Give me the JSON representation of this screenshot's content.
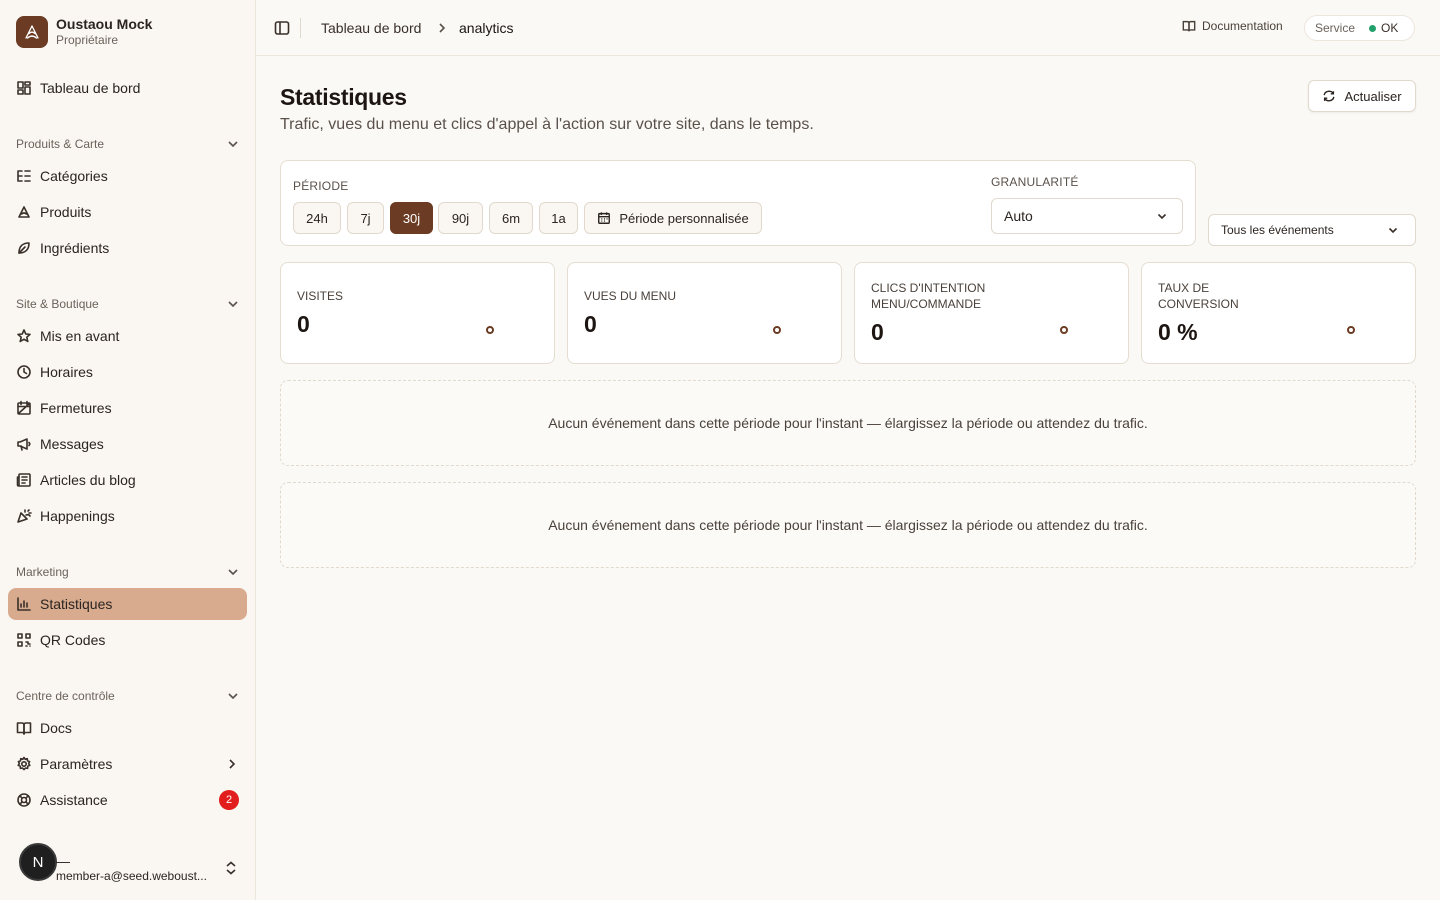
{
  "org": {
    "name": "Oustaou Mock",
    "role": "Propriétaire"
  },
  "nav": {
    "dashboard": "Tableau de bord",
    "sections": [
      {
        "title": "Produits & Carte",
        "items": [
          "Catégories",
          "Produits",
          "Ingrédients"
        ]
      },
      {
        "title": "Site & Boutique",
        "items": [
          "Mis en avant",
          "Horaires",
          "Fermetures",
          "Messages",
          "Articles du blog",
          "Happenings"
        ]
      },
      {
        "title": "Marketing",
        "items": [
          "Statistiques",
          "QR Codes"
        ]
      },
      {
        "title": "Centre de contrôle",
        "items": [
          "Docs",
          "Paramètres",
          "Assistance"
        ]
      }
    ],
    "active": "Statistiques",
    "assistance_badge": "2"
  },
  "user": {
    "initial": "N",
    "name": "—",
    "email": "member-a@seed.weboust..."
  },
  "topbar": {
    "breadcrumb": [
      "Tableau de bord",
      "analytics"
    ],
    "docs_label": "Documentation",
    "service_label": "Service",
    "service_status": "OK",
    "service_color": "#22a06b"
  },
  "page": {
    "title": "Statistiques",
    "subtitle": "Trafic, vues du menu et clics d'appel à l'action sur votre site, dans le temps.",
    "refresh_label": "Actualiser"
  },
  "filters": {
    "period_label": "PÉRIODE",
    "periods": [
      "24h",
      "7j",
      "30j",
      "90j",
      "6m",
      "1a"
    ],
    "active_period": "30j",
    "custom_label": "Période personnalisée",
    "granularity_label": "GRANULARITÉ",
    "granularity_value": "Auto",
    "events_value": "Tous les événements"
  },
  "stats": [
    {
      "label": "VISITES",
      "value": "0"
    },
    {
      "label": "VUES DU MENU",
      "value": "0"
    },
    {
      "label": "CLICS D'INTENTION MENU/COMMANDE",
      "value": "0"
    },
    {
      "label": "TAUX DE CONVERSION",
      "value": "0 %"
    }
  ],
  "empty": [
    "Aucun événement dans cette période pour l'instant — élargissez la période ou attendez du trafic.",
    "Aucun événement dans cette période pour l'instant — élargissez la période ou attendez du trafic."
  ],
  "colors": {
    "accent": "#6b3b23",
    "active_nav": "#d8ab8e",
    "badge": "#e11d1d"
  }
}
